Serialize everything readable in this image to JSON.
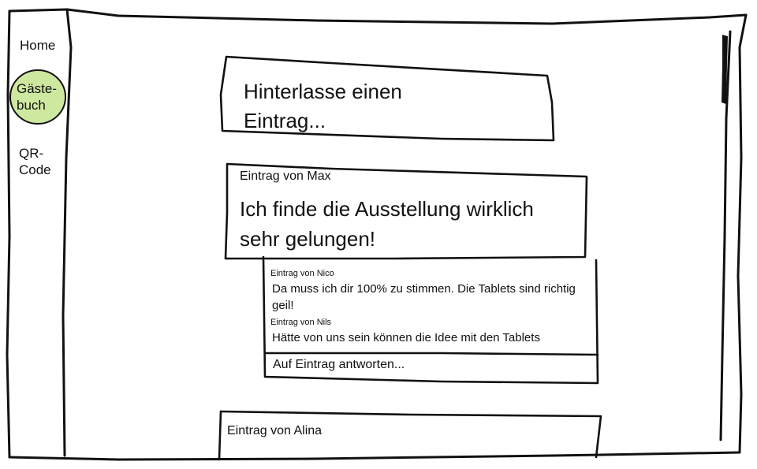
{
  "sidebar": {
    "items": [
      {
        "label": "Home",
        "active": false
      },
      {
        "label": "Gäste-\nbuch",
        "active": true
      },
      {
        "label": "QR-\nCode",
        "active": false
      }
    ],
    "active_color": "#cfe8a0"
  },
  "compose": {
    "placeholder": "Hinterlasse einen Eintrag..."
  },
  "entries": [
    {
      "author": "Eintrag von Max",
      "text": "Ich finde die Ausstellung wirklich sehr gelungen!",
      "replies": [
        {
          "author": "Eintrag von Nico",
          "text": "Da muss ich dir 100% zu stimmen. Die Tablets sind richtig geil!"
        },
        {
          "author": "Eintrag von Nils",
          "text": "Hätte von uns sein können die Idee mit den Tablets"
        }
      ],
      "reply_prompt": "Auf Eintrag antworten..."
    },
    {
      "author": "Eintrag von Alina"
    }
  ]
}
